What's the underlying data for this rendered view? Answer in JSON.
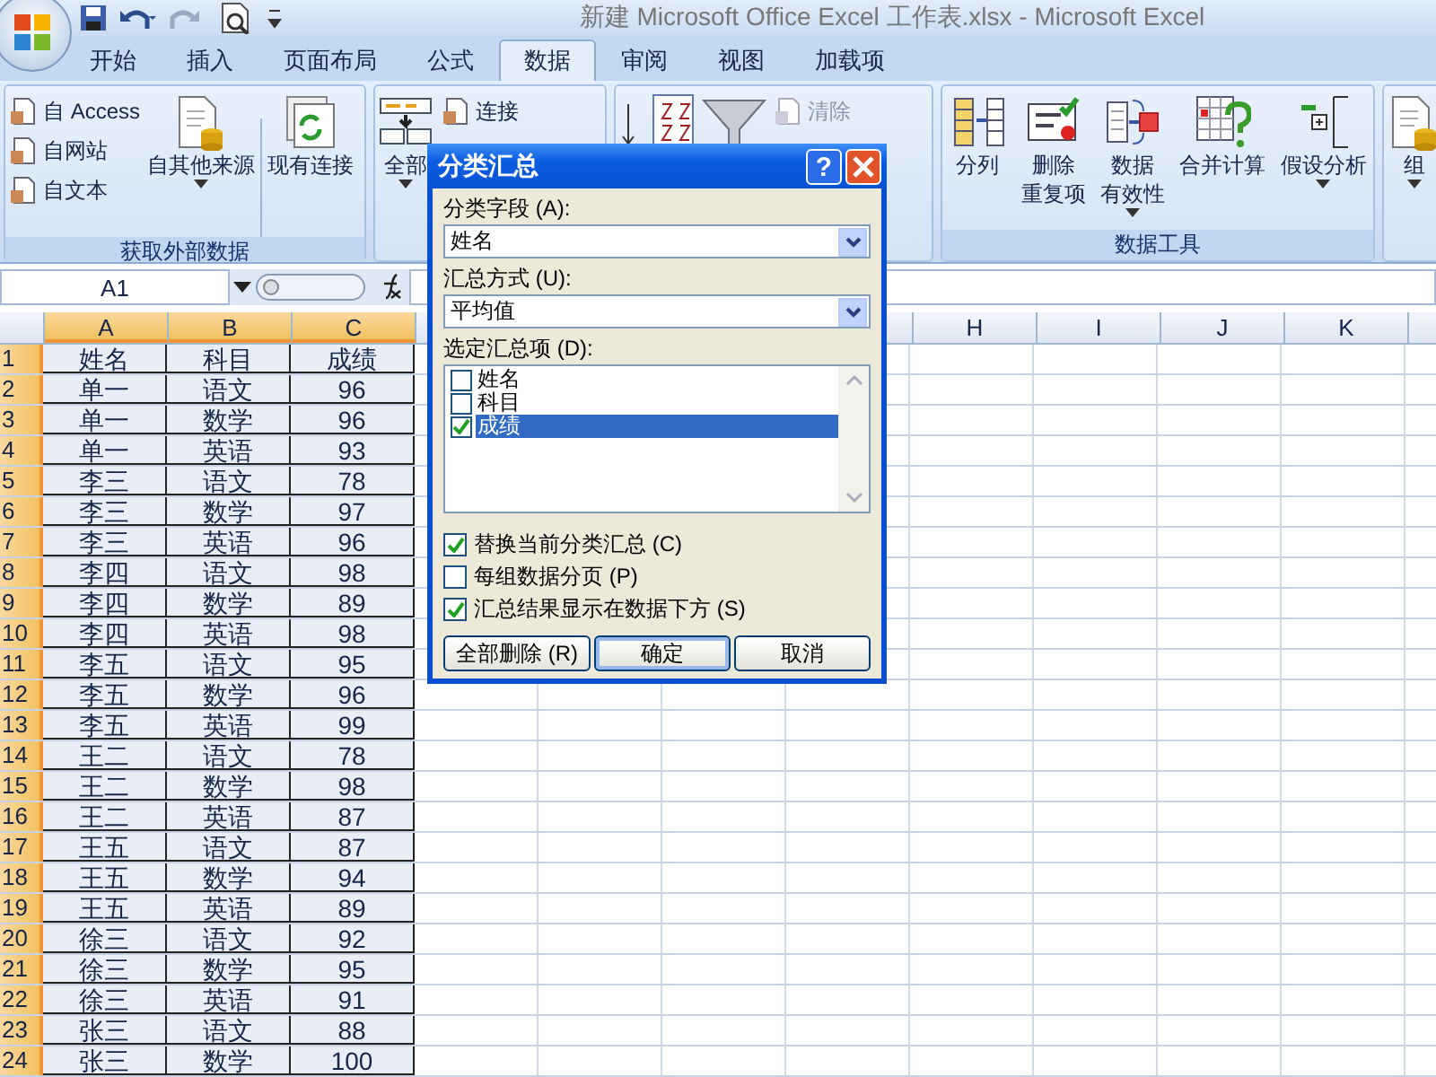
{
  "window": {
    "title": "新建 Microsoft Office Excel 工作表.xlsx - Microsoft Excel"
  },
  "tabs": [
    {
      "label": "开始",
      "selected": false
    },
    {
      "label": "插入",
      "selected": false
    },
    {
      "label": "页面布局",
      "selected": false
    },
    {
      "label": "公式",
      "selected": false
    },
    {
      "label": "数据",
      "selected": true
    },
    {
      "label": "审阅",
      "selected": false
    },
    {
      "label": "视图",
      "selected": false
    },
    {
      "label": "加载项",
      "selected": false
    }
  ],
  "ribbon_groups": [
    {
      "label": "获取外部数据",
      "items": [
        {
          "kind": "small",
          "label": "自 Access",
          "disabled": false
        },
        {
          "kind": "small",
          "label": "自网站",
          "disabled": false
        },
        {
          "kind": "small",
          "label": "自文本",
          "disabled": false
        },
        {
          "kind": "large",
          "lines": [
            "自其他来源"
          ],
          "dropdown": true
        },
        {
          "kind": "separator"
        },
        {
          "kind": "large",
          "lines": [
            "现有连接"
          ],
          "dropdown": false
        }
      ]
    },
    {
      "items": [
        {
          "kind": "large",
          "lines": [
            "全部"
          ],
          "dropdown": true
        },
        {
          "kind": "small",
          "label": "连接",
          "disabled": false
        }
      ]
    },
    {
      "items": [
        {
          "kind": "icon_only"
        },
        {
          "kind": "icon_only"
        },
        {
          "kind": "small",
          "label": "清除",
          "disabled": true
        }
      ]
    },
    {
      "label": "数据工具",
      "items": [
        {
          "kind": "large",
          "lines": [
            "分列"
          ],
          "dropdown": false
        },
        {
          "kind": "large",
          "lines": [
            "删除",
            "重复项"
          ],
          "dropdown": false
        },
        {
          "kind": "large",
          "lines": [
            "数据",
            "有效性"
          ],
          "dropdown": true
        },
        {
          "kind": "large",
          "lines": [
            "合并计算"
          ],
          "dropdown": false
        },
        {
          "kind": "large",
          "lines": [
            "假设分析"
          ],
          "dropdown": true
        }
      ]
    },
    {
      "items": [
        {
          "kind": "large",
          "lines": [
            "组"
          ],
          "dropdown": true
        }
      ]
    }
  ],
  "formula_bar": {
    "name_box": "A1"
  },
  "sheet": {
    "columns": [
      {
        "label": "A",
        "selected": true
      },
      {
        "label": "B",
        "selected": true
      },
      {
        "label": "C",
        "selected": true
      },
      {
        "label": "H",
        "selected": false
      },
      {
        "label": "I",
        "selected": false
      },
      {
        "label": "J",
        "selected": false
      },
      {
        "label": "K",
        "selected": false
      }
    ],
    "rows": [
      {
        "number": "1",
        "cells": [
          "姓名",
          "科目",
          "成绩"
        ]
      },
      {
        "number": "2",
        "cells": [
          "单一",
          "语文",
          "96"
        ]
      },
      {
        "number": "3",
        "cells": [
          "单一",
          "数学",
          "96"
        ]
      },
      {
        "number": "4",
        "cells": [
          "单一",
          "英语",
          "93"
        ]
      },
      {
        "number": "5",
        "cells": [
          "李三",
          "语文",
          "78"
        ]
      },
      {
        "number": "6",
        "cells": [
          "李三",
          "数学",
          "97"
        ]
      },
      {
        "number": "7",
        "cells": [
          "李三",
          "英语",
          "96"
        ]
      },
      {
        "number": "8",
        "cells": [
          "李四",
          "语文",
          "98"
        ]
      },
      {
        "number": "9",
        "cells": [
          "李四",
          "数学",
          "89"
        ]
      },
      {
        "number": "10",
        "cells": [
          "李四",
          "英语",
          "98"
        ]
      },
      {
        "number": "11",
        "cells": [
          "李五",
          "语文",
          "95"
        ]
      },
      {
        "number": "12",
        "cells": [
          "李五",
          "数学",
          "96"
        ]
      },
      {
        "number": "13",
        "cells": [
          "李五",
          "英语",
          "99"
        ]
      },
      {
        "number": "14",
        "cells": [
          "王二",
          "语文",
          "78"
        ]
      },
      {
        "number": "15",
        "cells": [
          "王二",
          "数学",
          "98"
        ]
      },
      {
        "number": "16",
        "cells": [
          "王二",
          "英语",
          "87"
        ]
      },
      {
        "number": "17",
        "cells": [
          "王五",
          "语文",
          "87"
        ]
      },
      {
        "number": "18",
        "cells": [
          "王五",
          "数学",
          "94"
        ]
      },
      {
        "number": "19",
        "cells": [
          "王五",
          "英语",
          "89"
        ]
      },
      {
        "number": "20",
        "cells": [
          "徐三",
          "语文",
          "92"
        ]
      },
      {
        "number": "21",
        "cells": [
          "徐三",
          "数学",
          "95"
        ]
      },
      {
        "number": "22",
        "cells": [
          "徐三",
          "英语",
          "91"
        ]
      },
      {
        "number": "23",
        "cells": [
          "张三",
          "语文",
          "88"
        ]
      },
      {
        "number": "24",
        "cells": [
          "张三",
          "数学",
          "100"
        ]
      }
    ]
  },
  "dialog": {
    "title": "分类汇总",
    "help": "?",
    "fields": [
      {
        "label": "分类字段 (A):",
        "value": "姓名"
      },
      {
        "label": "汇总方式 (U):",
        "value": "平均值"
      }
    ],
    "list_label": "选定汇总项 (D):",
    "list_items": [
      {
        "label": "姓名",
        "checked": false,
        "selected": false
      },
      {
        "label": "科目",
        "checked": false,
        "selected": false
      },
      {
        "label": "成绩",
        "checked": true,
        "selected": true
      }
    ],
    "options": [
      {
        "label": "替换当前分类汇总 (C)",
        "checked": true
      },
      {
        "label": "每组数据分页 (P)",
        "checked": false
      },
      {
        "label": "汇总结果显示在数据下方 (S)",
        "checked": true
      }
    ],
    "buttons": [
      {
        "label": "全部删除 (R)",
        "default": false
      },
      {
        "label": "确定",
        "default": true
      },
      {
        "label": "取消",
        "default": false
      }
    ]
  }
}
